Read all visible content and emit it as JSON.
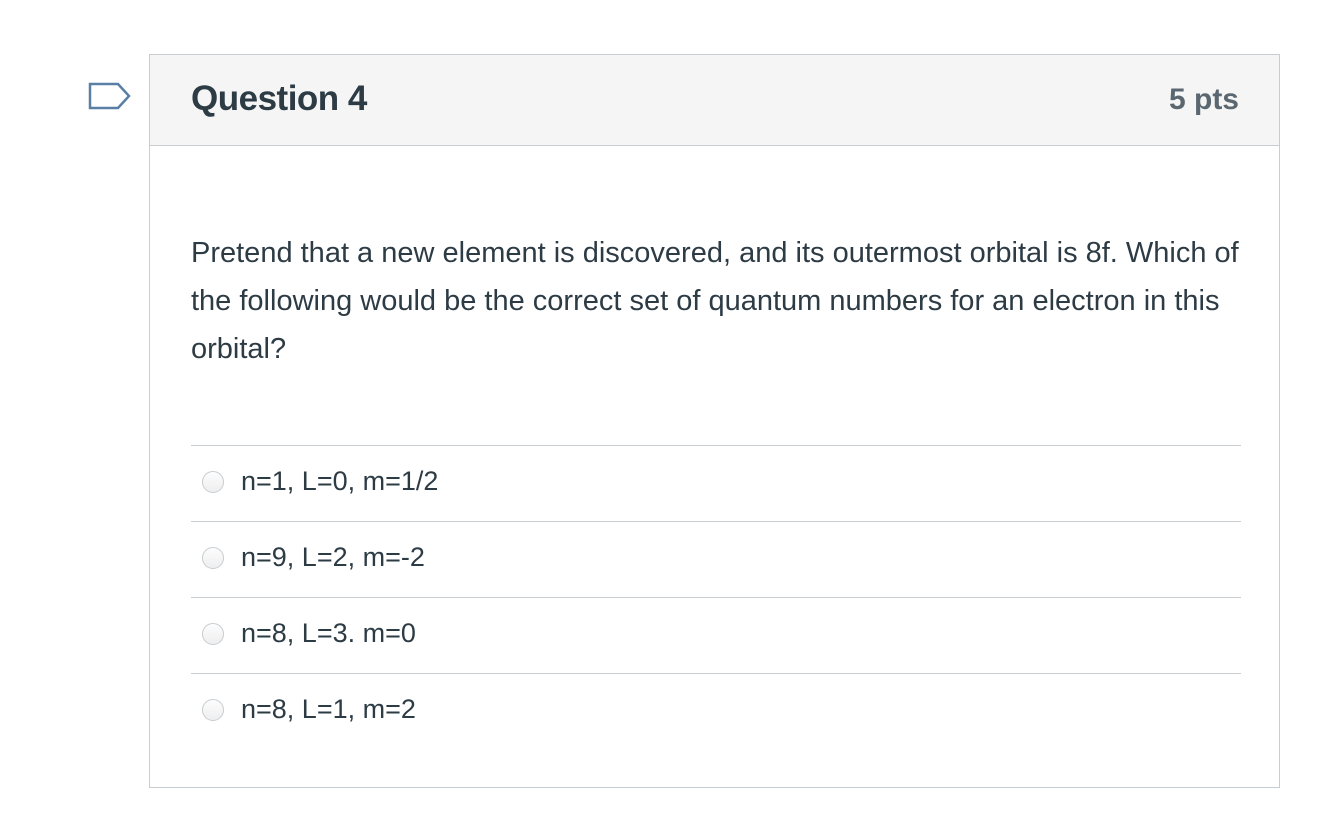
{
  "flag": {
    "icon": "flag-question-icon",
    "color": "#5a7fa6"
  },
  "question": {
    "title": "Question 4",
    "points": "5 pts",
    "text": "Pretend that a new element is discovered, and its outermost orbital is 8f. Which of the following would be the correct set of quantum numbers for an electron in this orbital?"
  },
  "answers": [
    {
      "label": "n=1, L=0, m=1/2",
      "selected": false
    },
    {
      "label": "n=9, L=2, m=-2",
      "selected": false
    },
    {
      "label": "n=8, L=3. m=0",
      "selected": false
    },
    {
      "label": "n=8, L=1, m=2",
      "selected": false
    }
  ],
  "colors": {
    "header_bg": "#f5f5f5",
    "border": "#c7cdd1",
    "text": "#2d3b45",
    "points_text": "#5b6770"
  }
}
